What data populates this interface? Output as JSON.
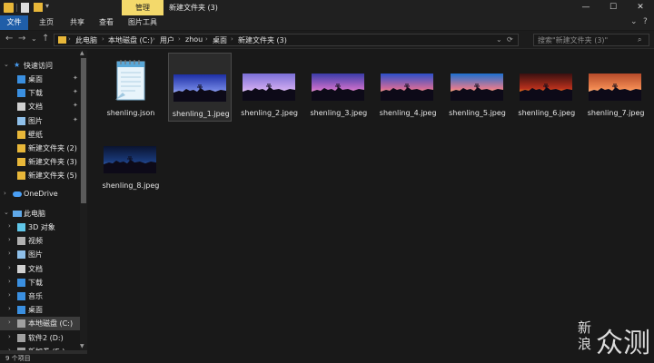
{
  "titlebar": {
    "context_tab": "管理",
    "title": "新建文件夹 (3)",
    "minimize": "—",
    "maximize": "☐",
    "close": "✕"
  },
  "ribbon": {
    "tabs": [
      {
        "label": "文件"
      },
      {
        "label": "主页"
      },
      {
        "label": "共享"
      },
      {
        "label": "查看"
      },
      {
        "label": "图片工具"
      }
    ],
    "collapse": "⌄",
    "help": "?"
  },
  "address": {
    "back": "←",
    "forward": "→",
    "recent": "⌄",
    "up": "↑",
    "crumbs": [
      "此电脑",
      "本地磁盘 (C:)",
      "用户",
      "zhou",
      "桌面",
      "新建文件夹 (3)"
    ],
    "dropdown": "⌄",
    "refresh": "⟳",
    "search_placeholder": "搜索\"新建文件夹 (3)\"",
    "search_icon": "⌕"
  },
  "sidebar": {
    "quick_access": "快速访问",
    "quick_items": [
      {
        "label": "桌面",
        "icon": "desktop-icon",
        "pinned": true
      },
      {
        "label": "下载",
        "icon": "download-icon",
        "pinned": true
      },
      {
        "label": "文档",
        "icon": "document-icon",
        "pinned": true
      },
      {
        "label": "图片",
        "icon": "picture-icon",
        "pinned": true
      },
      {
        "label": "壁纸",
        "icon": "folder-icon",
        "pinned": false
      },
      {
        "label": "新建文件夹 (2)",
        "icon": "folder-icon",
        "pinned": false
      },
      {
        "label": "新建文件夹 (3)",
        "icon": "folder-icon",
        "pinned": false
      },
      {
        "label": "新建文件夹 (5)",
        "icon": "folder-icon",
        "pinned": false
      }
    ],
    "onedrive": "OneDrive",
    "this_pc": "此电脑",
    "pc_items": [
      {
        "label": "3D 对象",
        "icon": "3d-objects-icon"
      },
      {
        "label": "视频",
        "icon": "video-icon"
      },
      {
        "label": "图片",
        "icon": "picture-icon"
      },
      {
        "label": "文档",
        "icon": "document-icon"
      },
      {
        "label": "下载",
        "icon": "download-icon"
      },
      {
        "label": "音乐",
        "icon": "music-icon"
      },
      {
        "label": "桌面",
        "icon": "desktop-icon"
      },
      {
        "label": "本地磁盘 (C:)",
        "icon": "drive-icon"
      },
      {
        "label": "软件2 (D:)",
        "icon": "drive-icon"
      },
      {
        "label": "新加卷 (E:)",
        "icon": "drive-icon"
      }
    ]
  },
  "files": [
    {
      "name": "shenling.json",
      "type": "json"
    },
    {
      "name": "shenling_1.jpeg",
      "type": "image",
      "sky_top": "#1d2fa6",
      "sky_mid": "#6c7fe0",
      "glow": "#c8d4ff"
    },
    {
      "name": "shenling_2.jpeg",
      "type": "image",
      "sky_top": "#7a6fd6",
      "sky_mid": "#c9a6ee",
      "glow": "#f4e0ff"
    },
    {
      "name": "shenling_3.jpeg",
      "type": "image",
      "sky_top": "#3a3ca8",
      "sky_mid": "#c06bc8",
      "glow": "#ffb3d0"
    },
    {
      "name": "shenling_4.jpeg",
      "type": "image",
      "sky_top": "#2b4fc9",
      "sky_mid": "#d06a9a",
      "glow": "#ffc27a"
    },
    {
      "name": "shenling_5.jpeg",
      "type": "image",
      "sky_top": "#1b6fd0",
      "sky_mid": "#e07a90",
      "glow": "#ffd36a"
    },
    {
      "name": "shenling_6.jpeg",
      "type": "image",
      "sky_top": "#3a1010",
      "sky_mid": "#b8301c",
      "glow": "#ffb02a"
    },
    {
      "name": "shenling_7.jpeg",
      "type": "image",
      "sky_top": "#b54a2a",
      "sky_mid": "#f28a52",
      "glow": "#ffd2a0"
    },
    {
      "name": "shenling_8.jpeg",
      "type": "image",
      "sky_top": "#0a1430",
      "sky_mid": "#1a3a7a",
      "glow": "#3a6ac0"
    }
  ],
  "status": {
    "count": "9 个项目"
  },
  "watermark": {
    "line1": "新",
    "line2": "浪",
    "big": "众测"
  },
  "colors": {
    "accent": "#1f5ea8",
    "context_tab": "#f3d96b",
    "folder": "#e8b739"
  }
}
